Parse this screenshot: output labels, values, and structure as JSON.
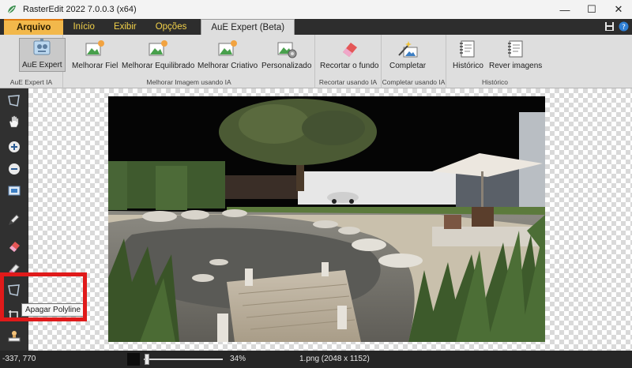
{
  "window": {
    "title": "RasterEdit 2022 7.0.0.3 (x64)",
    "controls": {
      "minimize": "—",
      "maximize": "☐",
      "close": "✕"
    }
  },
  "menu_tabs": [
    {
      "label": "Arquivo"
    },
    {
      "label": "Início"
    },
    {
      "label": "Exibir"
    },
    {
      "label": "Opções"
    },
    {
      "label": "AuE Expert (Beta)"
    }
  ],
  "ribbon": {
    "groups": [
      {
        "label": "AuE Expert IA",
        "buttons": [
          {
            "label": "AuE Expert",
            "icon": "ai-expert-icon"
          }
        ]
      },
      {
        "label": "Melhorar Imagem usando IA",
        "buttons": [
          {
            "label": "Melhorar Fiel",
            "icon": "image-enhance-icon"
          },
          {
            "label": "Melhorar Equilibrado",
            "icon": "image-enhance-icon"
          },
          {
            "label": "Melhorar Criativo",
            "icon": "image-enhance-icon"
          },
          {
            "label": "Personalizado",
            "icon": "image-settings-icon"
          }
        ]
      },
      {
        "label": "Recortar usando IA",
        "buttons": [
          {
            "label": "Recortar o fundo",
            "icon": "eraser-icon"
          }
        ]
      },
      {
        "label": "Completar usando IA",
        "buttons": [
          {
            "label": "Completar",
            "icon": "magic-wand-icon"
          }
        ]
      },
      {
        "label": "Histórico",
        "buttons": [
          {
            "label": "Histórico",
            "icon": "history-notebook-icon"
          },
          {
            "label": "Rever imagens",
            "icon": "review-notebook-icon"
          }
        ]
      }
    ]
  },
  "left_tools": [
    "polygon-select-icon",
    "hand-pan-icon",
    "zoom-in-icon",
    "zoom-out-icon",
    "fit-screen-icon",
    "pen-icon",
    "eraser-icon",
    "pencil-icon",
    "erase-polyline-icon",
    "crop-icon",
    "stamp-icon"
  ],
  "tooltip": {
    "text": "Apagar Polyline"
  },
  "status": {
    "coords": "-337, 770",
    "zoom_percent": "34%",
    "zoom_fraction": 0.34,
    "file": "1.png (2048 x 1152)"
  },
  "colors": {
    "accent_file_tab": "#f2b84b",
    "tab_text": "#f3d24a",
    "highlight_box": "#e01a1a"
  }
}
